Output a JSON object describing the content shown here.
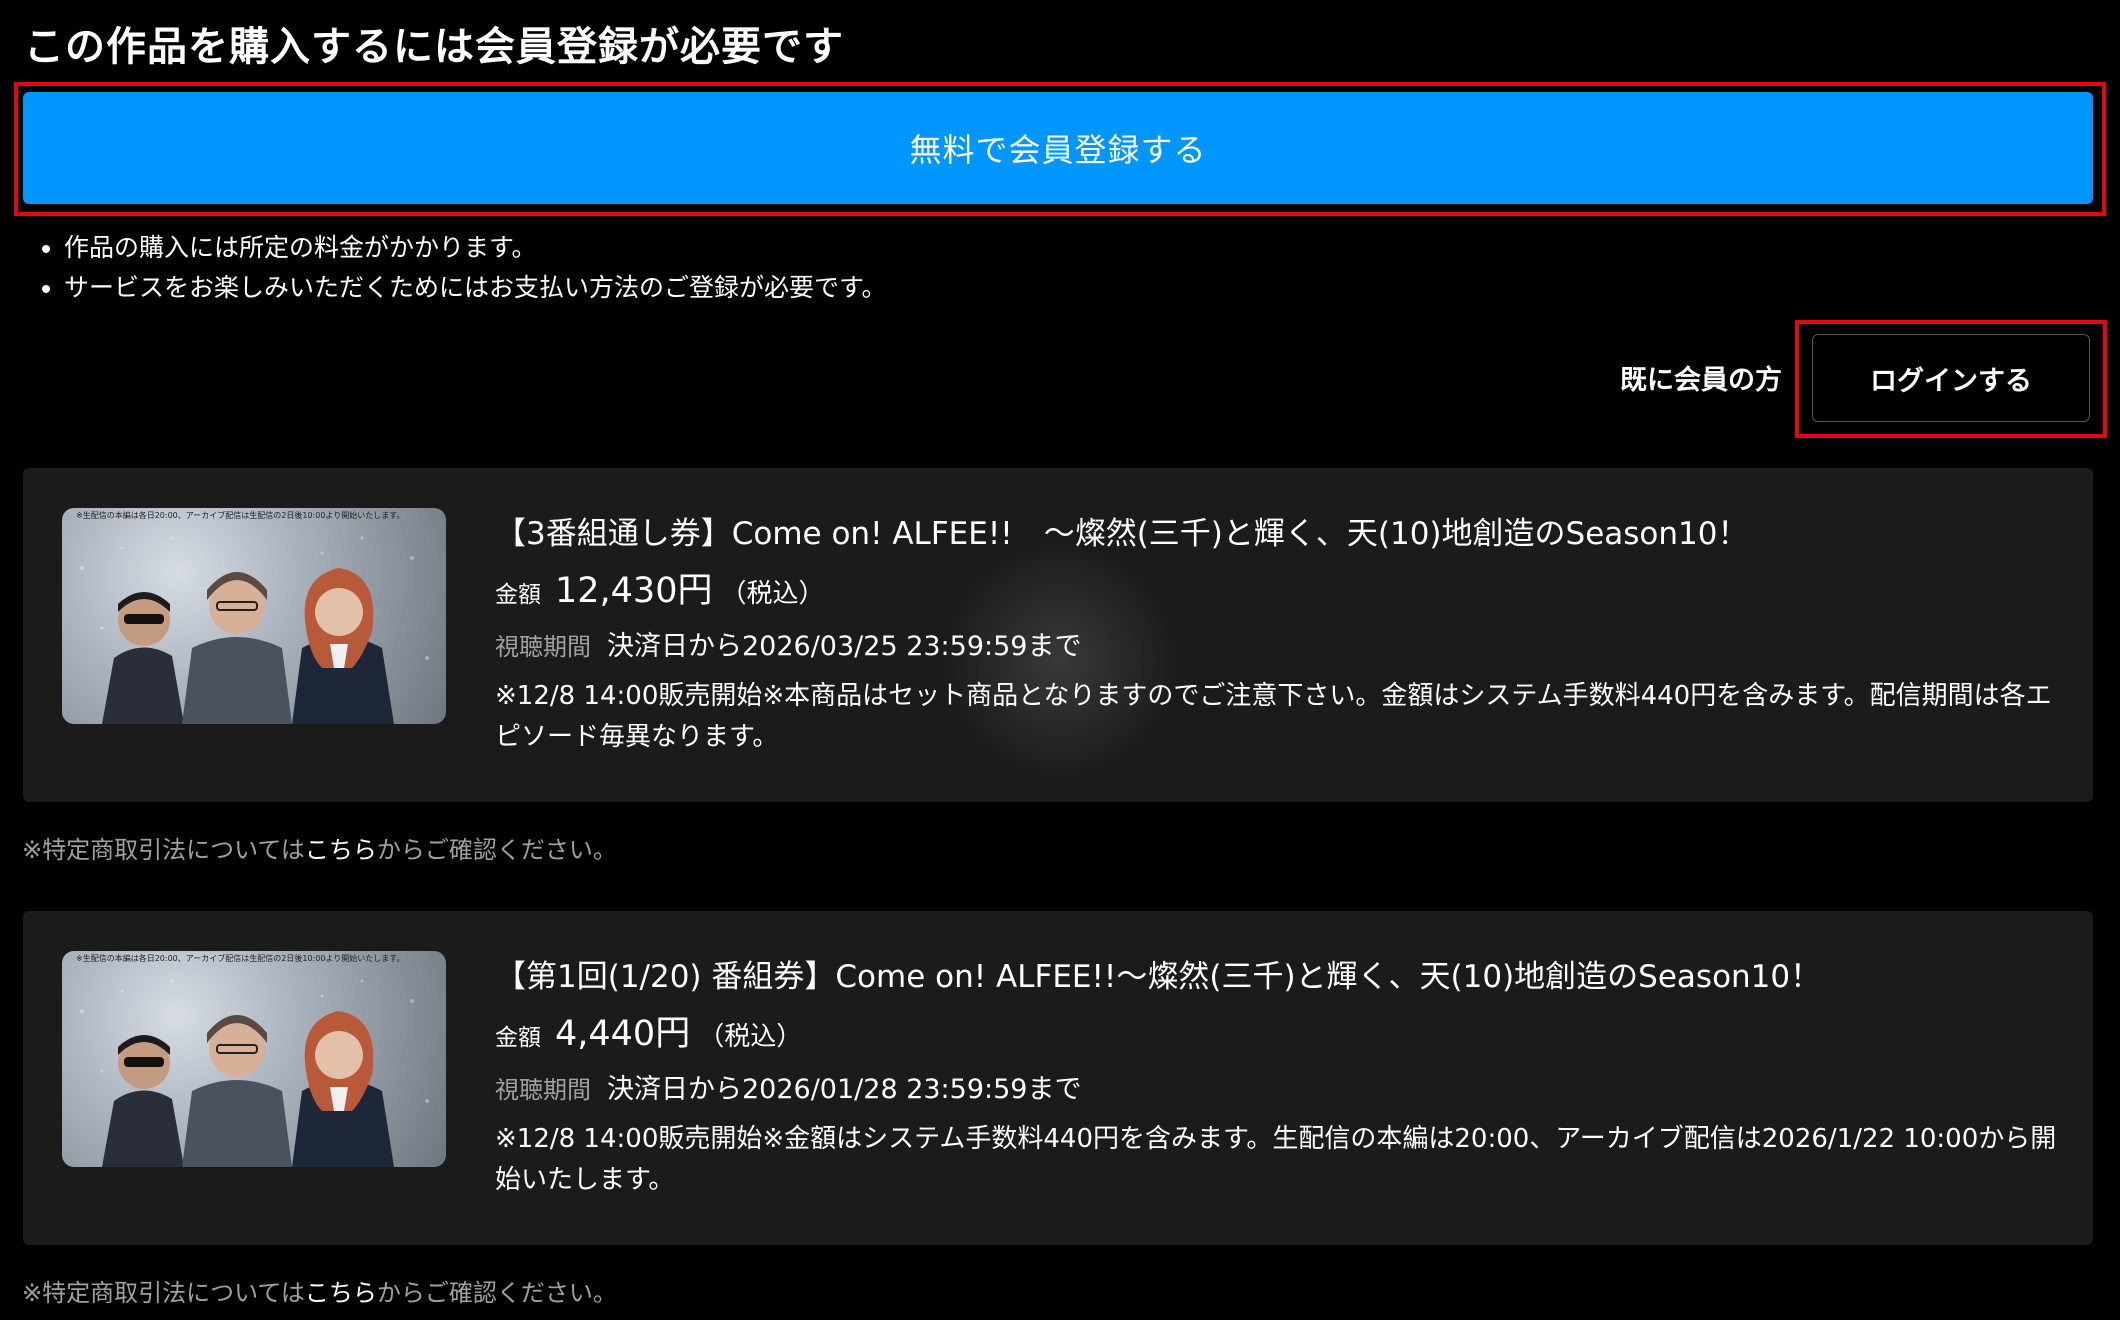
{
  "page_title": "この作品を購入するには会員登録が必要です",
  "register_button": "無料で会員登録する",
  "notes": [
    "作品の購入には所定の料金がかかります。",
    "サービスをお楽しみいただくためにはお支払い方法のご登録が必要です。"
  ],
  "member_label": "既に会員の方",
  "login_button": "ログインする",
  "highlight_color": "#e30613",
  "accent_color": "#0096ff",
  "products": [
    {
      "thumbnail_caption": "※生配信の本編は各日20:00、アーカイブ配信は生配信の2日後10:00より開始いたします。",
      "title": "【3番組通し券】Come on! ALFEE!!　〜燦然(三千)と輝く、天(10)地創造のSeason10！",
      "price_label": "金額",
      "price": "12,430円",
      "tax": "（税込）",
      "period_label": "視聴期間",
      "period": "決済日から2026/03/25 23:59:59まで",
      "description": "※12/8 14:00販売開始※本商品はセット商品となりますのでご注意下さい。金額はシステム手数料440円を含みます。配信期間は各エピソード毎異なります。"
    },
    {
      "thumbnail_caption": "※生配信の本編は各日20:00、アーカイブ配信は生配信の2日後10:00より開始いたします。",
      "title": "【第1回(1/20) 番組券】Come on! ALFEE!!〜燦然(三千)と輝く、天(10)地創造のSeason10！",
      "price_label": "金額",
      "price": "4,440円",
      "tax": "（税込）",
      "period_label": "視聴期間",
      "period": "決済日から2026/01/28 23:59:59まで",
      "description": "※12/8 14:00販売開始※金額はシステム手数料440円を含みます。生配信の本編は20:00、アーカイブ配信は2026/1/22 10:00から開始いたします。"
    }
  ],
  "legal": {
    "prefix": "※特定商取引法については",
    "link": "こちら",
    "suffix": "からご確認ください。"
  }
}
